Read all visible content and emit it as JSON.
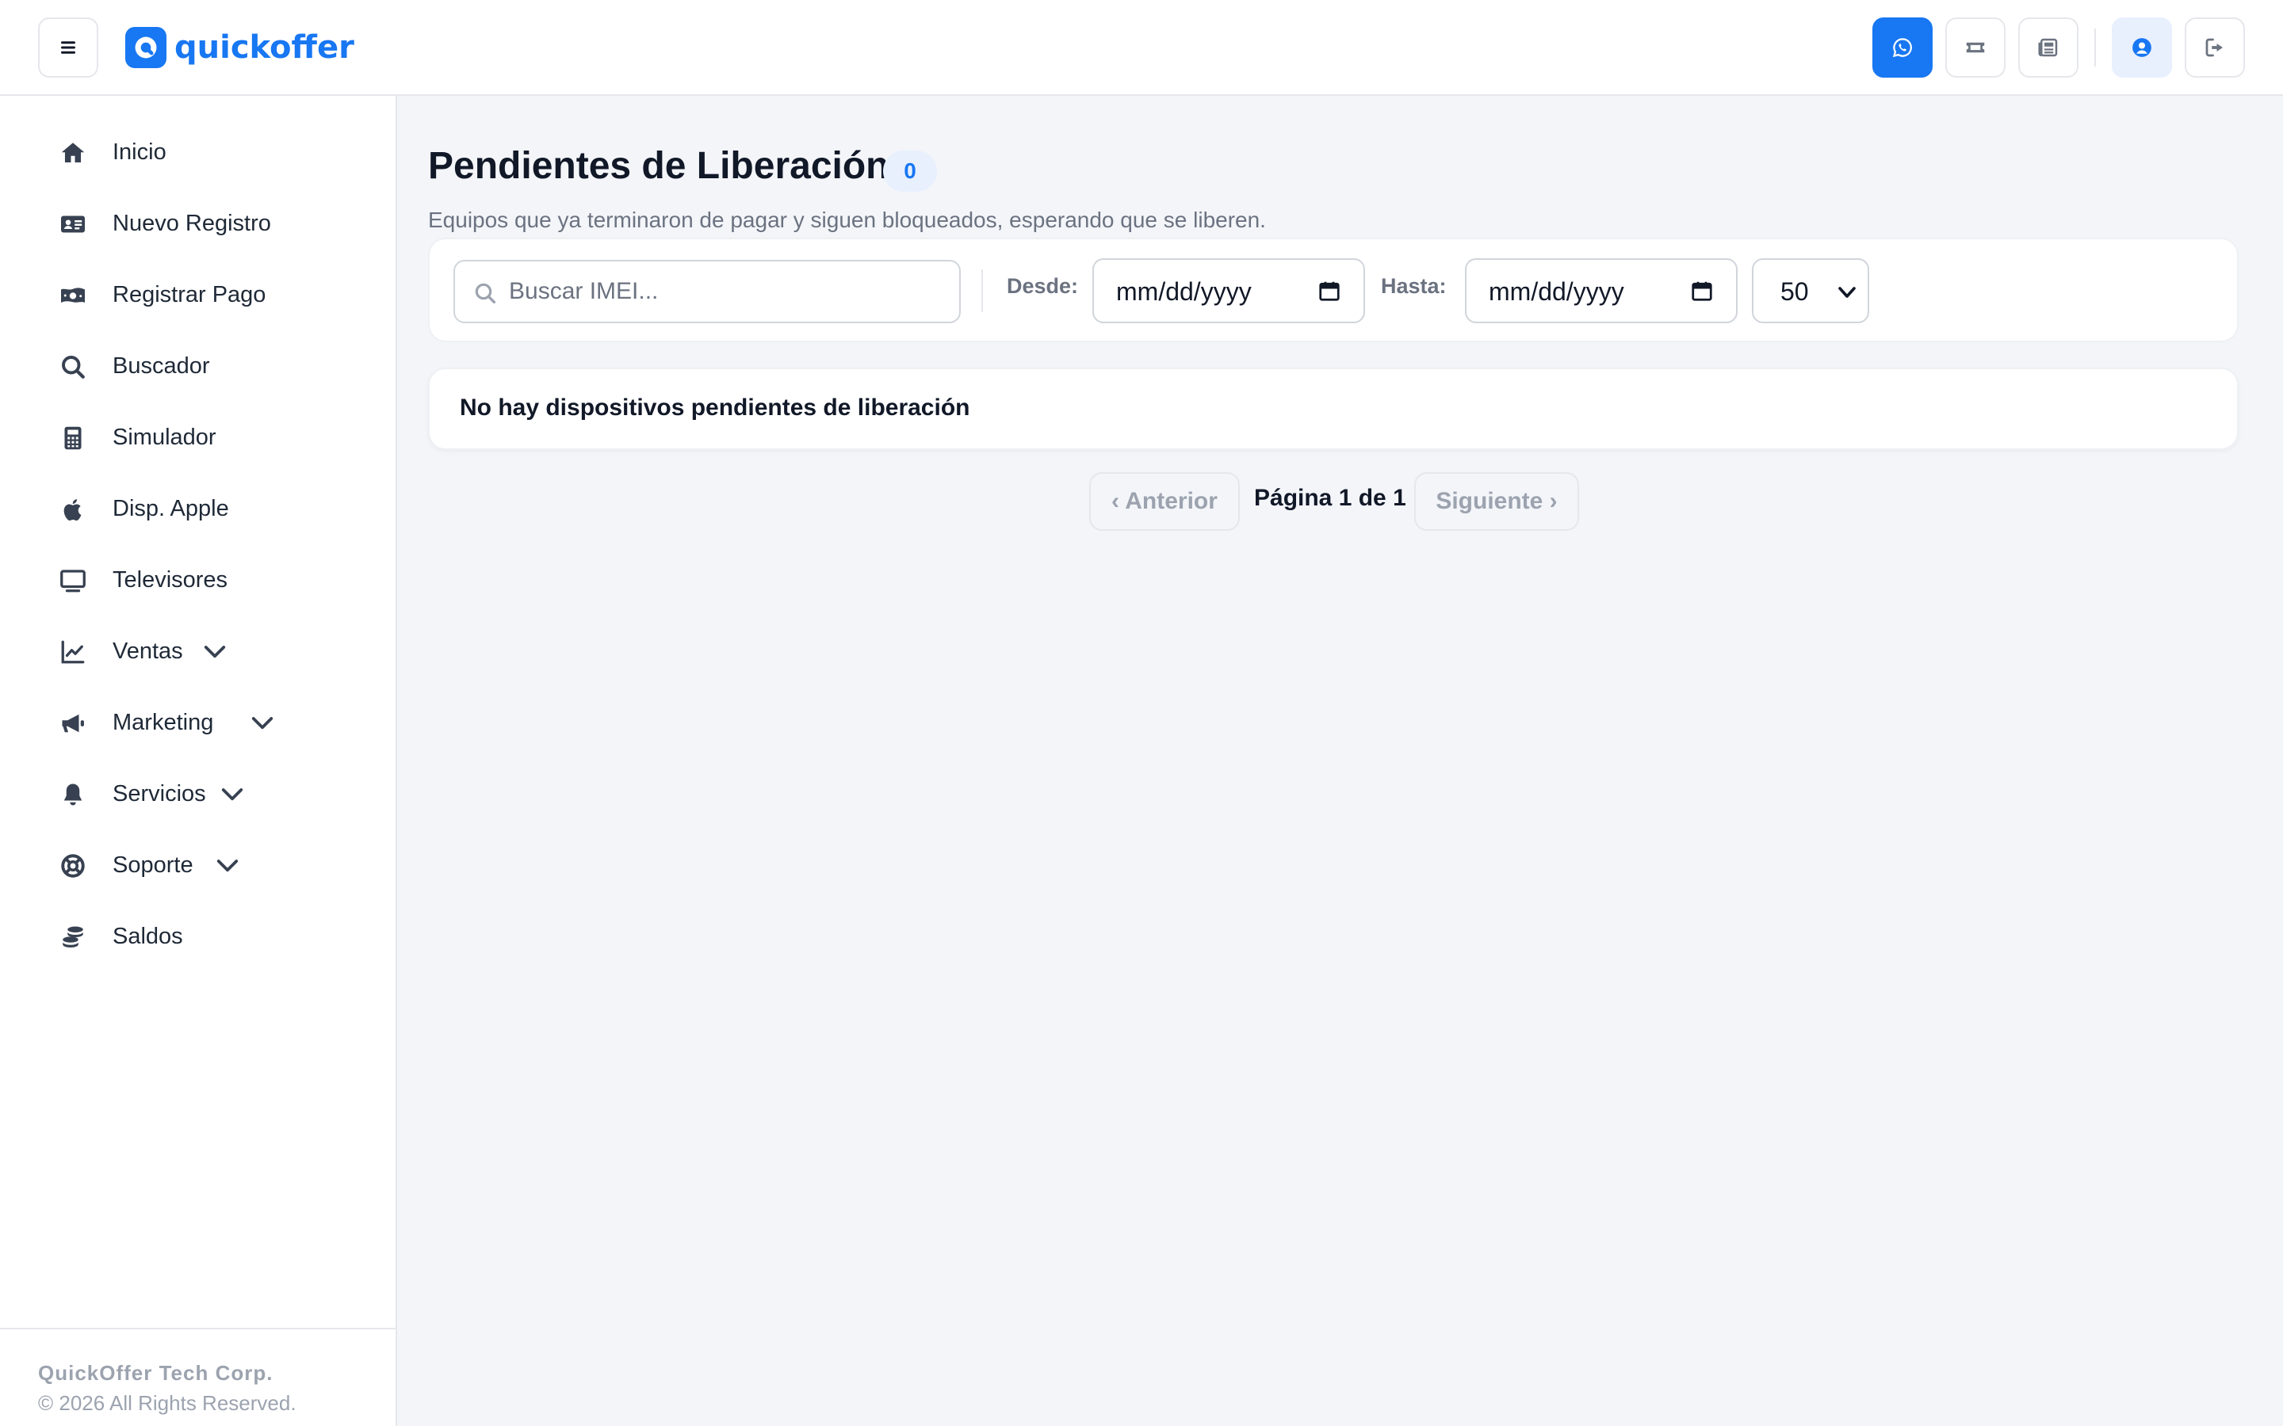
{
  "app": {
    "logo_text": "quickoffer",
    "brand_color": "#1877f2"
  },
  "topbar": {
    "menu_icon": "hamburger-icon",
    "actions": [
      {
        "name": "whatsapp",
        "icon": "whatsapp-icon",
        "active": true
      },
      {
        "name": "ticket",
        "icon": "ticket-icon"
      },
      {
        "name": "news",
        "icon": "newspaper-icon"
      },
      {
        "name": "user",
        "icon": "user-circle-icon"
      },
      {
        "name": "logout",
        "icon": "logout-icon"
      }
    ]
  },
  "sidebar": {
    "items": [
      {
        "label": "Inicio",
        "icon": "home-icon"
      },
      {
        "label": "Nuevo Registro",
        "icon": "id-card-icon"
      },
      {
        "label": "Registrar Pago",
        "icon": "money-icon"
      },
      {
        "label": "Buscador",
        "icon": "search-icon"
      },
      {
        "label": "Simulador",
        "icon": "calculator-icon"
      },
      {
        "label": "Disp. Apple",
        "icon": "apple-icon"
      },
      {
        "label": "Televisores",
        "icon": "tv-icon"
      },
      {
        "label": "Ventas",
        "icon": "chart-line-icon",
        "expandable": true
      },
      {
        "label": "Marketing",
        "icon": "megaphone-icon",
        "expandable": true
      },
      {
        "label": "Servicios",
        "icon": "bell-icon",
        "expandable": true
      },
      {
        "label": "Soporte",
        "icon": "lifebuoy-icon",
        "expandable": true
      },
      {
        "label": "Saldos",
        "icon": "coins-icon"
      }
    ],
    "footer": {
      "company": "QuickOffer Tech Corp.",
      "copyright": "© 2026 All Rights Reserved."
    }
  },
  "main": {
    "title": "Pendientes de Liberación",
    "count": "0",
    "subtitle": "Equipos que ya terminaron de pagar y siguen bloqueados, esperando que se liberen.",
    "filters": {
      "search_placeholder": "Buscar IMEI...",
      "from_label": "Desde:",
      "from_value": "mm/dd/yyyy",
      "to_label": "Hasta:",
      "to_value": "mm/dd/yyyy",
      "per_page": "50"
    },
    "empty_message": "No hay dispositivos pendientes de liberación",
    "pagination": {
      "prev": "‹ Anterior",
      "info": "Página 1 de 1",
      "next": "Siguiente ›"
    }
  }
}
